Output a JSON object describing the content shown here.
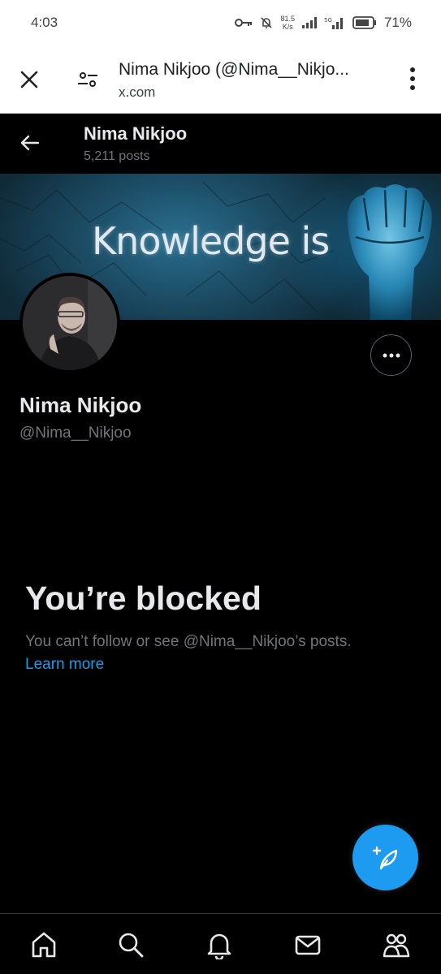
{
  "status_bar": {
    "time": "4:03",
    "speed_value": "81.5",
    "speed_unit": "K/s",
    "battery": "71%",
    "icons": [
      "key-icon",
      "mute-bell-icon",
      "signal-icon",
      "5g-signal-icon",
      "battery-icon"
    ]
  },
  "browser": {
    "title": "Nima Nikjoo (@Nima__Nikjo...",
    "url": "x.com",
    "icons": [
      "close-icon",
      "tune-icon",
      "more-vert-icon"
    ]
  },
  "header": {
    "name": "Nima Nikjoo",
    "posts": "5,211 posts"
  },
  "banner": {
    "text": "Knowledge is"
  },
  "profile": {
    "name": "Nima Nikjoo",
    "handle": "@Nima__Nikjoo"
  },
  "blocked": {
    "title": "You’re blocked",
    "description": "You can’t follow or see @Nima__Nikjoo’s posts.",
    "link": "Learn more"
  },
  "bottom_nav": {
    "items": [
      "home-icon",
      "search-icon",
      "bell-icon",
      "mail-icon",
      "communities-icon"
    ]
  },
  "colors": {
    "background": "#000000",
    "accent": "#1d9bf0",
    "text_primary": "#e7e9ea",
    "text_secondary": "#71767b",
    "border": "#2f3336"
  }
}
